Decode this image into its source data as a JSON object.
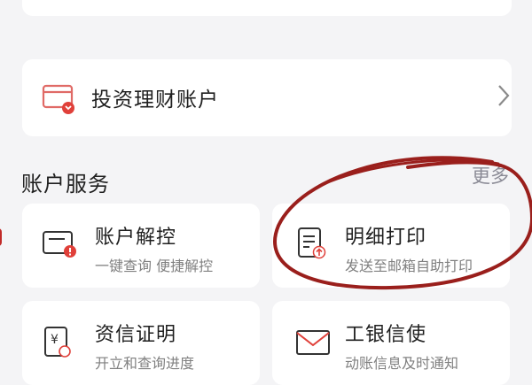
{
  "invest_account": {
    "label": "投资理财账户"
  },
  "account_services": {
    "title": "账户服务",
    "more_label": "更多"
  },
  "services": [
    {
      "title": "账户解控",
      "subtitle": "一键查询 便捷解控",
      "icon": "card-lock-icon"
    },
    {
      "title": "明细打印",
      "subtitle": "发送至邮箱自助打印",
      "icon": "document-print-icon"
    },
    {
      "title": "资信证明",
      "subtitle": "开立和查询进度",
      "icon": "yuan-certificate-icon"
    },
    {
      "title": "工银信使",
      "subtitle": "动账信息及时通知",
      "icon": "envelope-icon"
    }
  ],
  "colors": {
    "accent_red": "#e0403a",
    "annotation": "#9a1f1c",
    "background": "#f4f4f6"
  }
}
